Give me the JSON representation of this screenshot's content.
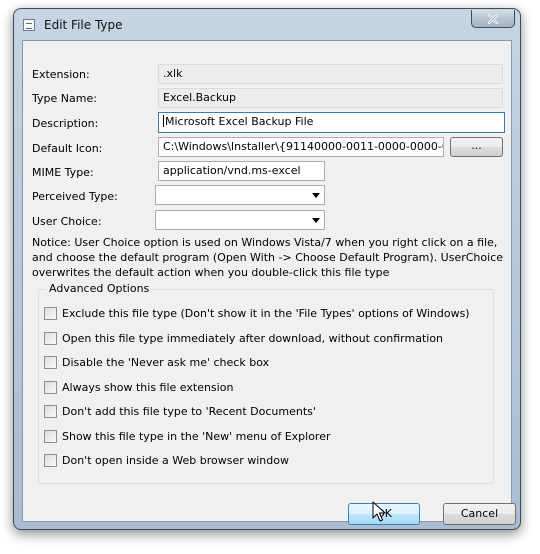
{
  "window": {
    "title": "Edit File Type"
  },
  "form": {
    "extension": {
      "label": "Extension:",
      "value": ".xlk"
    },
    "type_name": {
      "label": "Type Name:",
      "value": "Excel.Backup"
    },
    "description": {
      "label": "Description:",
      "value": "Microsoft Excel Backup File"
    },
    "default_icon": {
      "label": "Default Icon:",
      "value": "C:\\Windows\\Installer\\{91140000-0011-0000-0000-000000",
      "browse_label": "..."
    },
    "mime_type": {
      "label": "MIME Type:",
      "value": "application/vnd.ms-excel"
    },
    "perceived_type": {
      "label": "Perceived Type:",
      "value": ""
    },
    "user_choice": {
      "label": "User Choice:",
      "value": ""
    }
  },
  "notice": "Notice: User Choice option is used on Windows Vista/7 when you right click on a file, and choose the default program (Open With -> Choose Default Program). UserChoice overwrites the default action when you double-click this file type",
  "advanced": {
    "title": "Advanced Options",
    "options": [
      {
        "label": "Exclude  this file type (Don't show it in the 'File Types' options of Windows)",
        "checked": false
      },
      {
        "label": "Open this file type immediately after download, without confirmation",
        "checked": false
      },
      {
        "label": "Disable the 'Never ask me' check box",
        "checked": false
      },
      {
        "label": "Always show this file extension",
        "checked": false
      },
      {
        "label": "Don't add this file type to 'Recent Documents'",
        "checked": false
      },
      {
        "label": "Show this file type in the 'New' menu of Explorer",
        "checked": false
      },
      {
        "label": "Don't open inside a Web browser window",
        "checked": false
      }
    ]
  },
  "buttons": {
    "ok": "OK",
    "cancel": "Cancel"
  },
  "icons": {
    "title": "window-icon",
    "close": "close-icon",
    "cursor": "mouse-pointer-icon"
  }
}
